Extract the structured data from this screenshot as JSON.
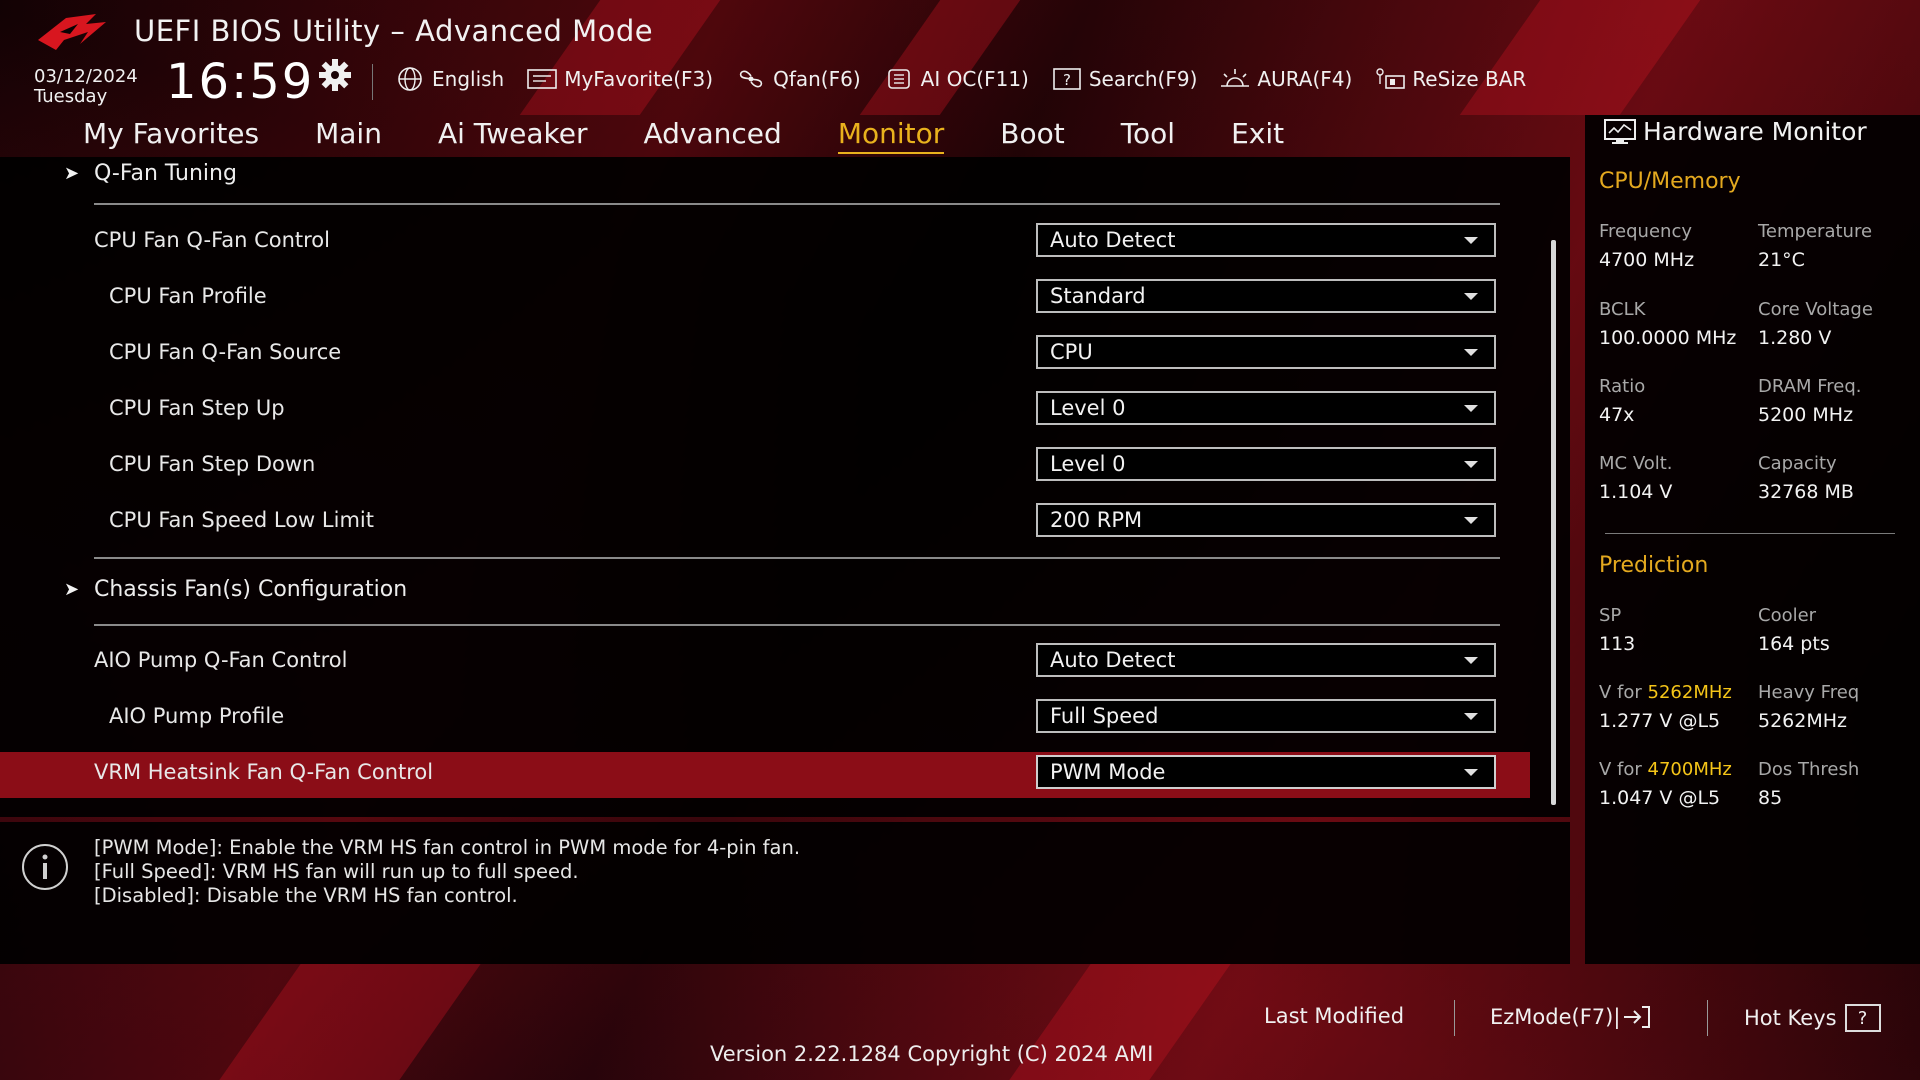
{
  "header": {
    "title": "UEFI BIOS Utility – Advanced Mode",
    "date": "03/12/2024",
    "day": "Tuesday",
    "time": "16:59"
  },
  "toolbar": {
    "language": "English",
    "myfavorite": "MyFavorite(F3)",
    "qfan": "Qfan(F6)",
    "aioc": "AI OC(F11)",
    "search": "Search(F9)",
    "aura": "AURA(F4)",
    "resize": "ReSize BAR"
  },
  "tabs": [
    "My Favorites",
    "Main",
    "Ai Tweaker",
    "Advanced",
    "Monitor",
    "Boot",
    "Tool",
    "Exit"
  ],
  "main": {
    "qfan_tuning": "Q-Fan Tuning",
    "chassis": "Chassis Fan(s) Configuration",
    "rows": [
      {
        "label": "CPU Fan Q-Fan Control",
        "value": "Auto Detect"
      },
      {
        "label": "CPU Fan Profile",
        "value": "Standard"
      },
      {
        "label": "CPU Fan Q-Fan Source",
        "value": "CPU"
      },
      {
        "label": "CPU Fan Step Up",
        "value": "Level 0"
      },
      {
        "label": "CPU Fan Step Down",
        "value": "Level 0"
      },
      {
        "label": "CPU Fan Speed Low Limit",
        "value": "200 RPM"
      },
      {
        "label": "AIO Pump Q-Fan Control",
        "value": "Auto Detect"
      },
      {
        "label": "AIO Pump Profile",
        "value": "Full Speed"
      },
      {
        "label": "VRM Heatsink Fan Q-Fan Control",
        "value": "PWM Mode"
      }
    ]
  },
  "help": {
    "lines": [
      "[PWM Mode]: Enable the VRM HS fan control in PWM mode for 4-pin fan.",
      "[Full Speed]: VRM HS fan will run up to full speed.",
      "[Disabled]: Disable the VRM HS fan control."
    ]
  },
  "hw": {
    "title": "Hardware Monitor",
    "cpu_memory": "CPU/Memory",
    "frequency_label": "Frequency",
    "frequency": "4700 MHz",
    "temperature_label": "Temperature",
    "temperature": "21°C",
    "bclk_label": "BCLK",
    "bclk": "100.0000 MHz",
    "corev_label": "Core Voltage",
    "corev": "1.280 V",
    "ratio_label": "Ratio",
    "ratio": "47x",
    "dram_label": "DRAM Freq.",
    "dram": "5200 MHz",
    "mcv_label": "MC Volt.",
    "mcv": "1.104 V",
    "capacity_label": "Capacity",
    "capacity": "32768 MB",
    "prediction": "Prediction",
    "sp_label": "SP",
    "sp": "113",
    "cooler_label": "Cooler",
    "cooler": "164 pts",
    "vfor1_prefix": "V for ",
    "vfor1_freq": "5262MHz",
    "vfor1": "1.277 V @L5",
    "heavy_label": "Heavy Freq",
    "heavy": "5262MHz",
    "vfor2_prefix": "V for ",
    "vfor2_freq": "4700MHz",
    "vfor2": "1.047 V @L5",
    "dos_label": "Dos Thresh",
    "dos": "85"
  },
  "footer": {
    "last_modified": "Last Modified",
    "ezmode": "EzMode(F7)|",
    "hotkeys": "Hot Keys",
    "hotkeys_key": "?",
    "version": "Version 2.22.1284 Copyright (C) 2024 AMI"
  }
}
